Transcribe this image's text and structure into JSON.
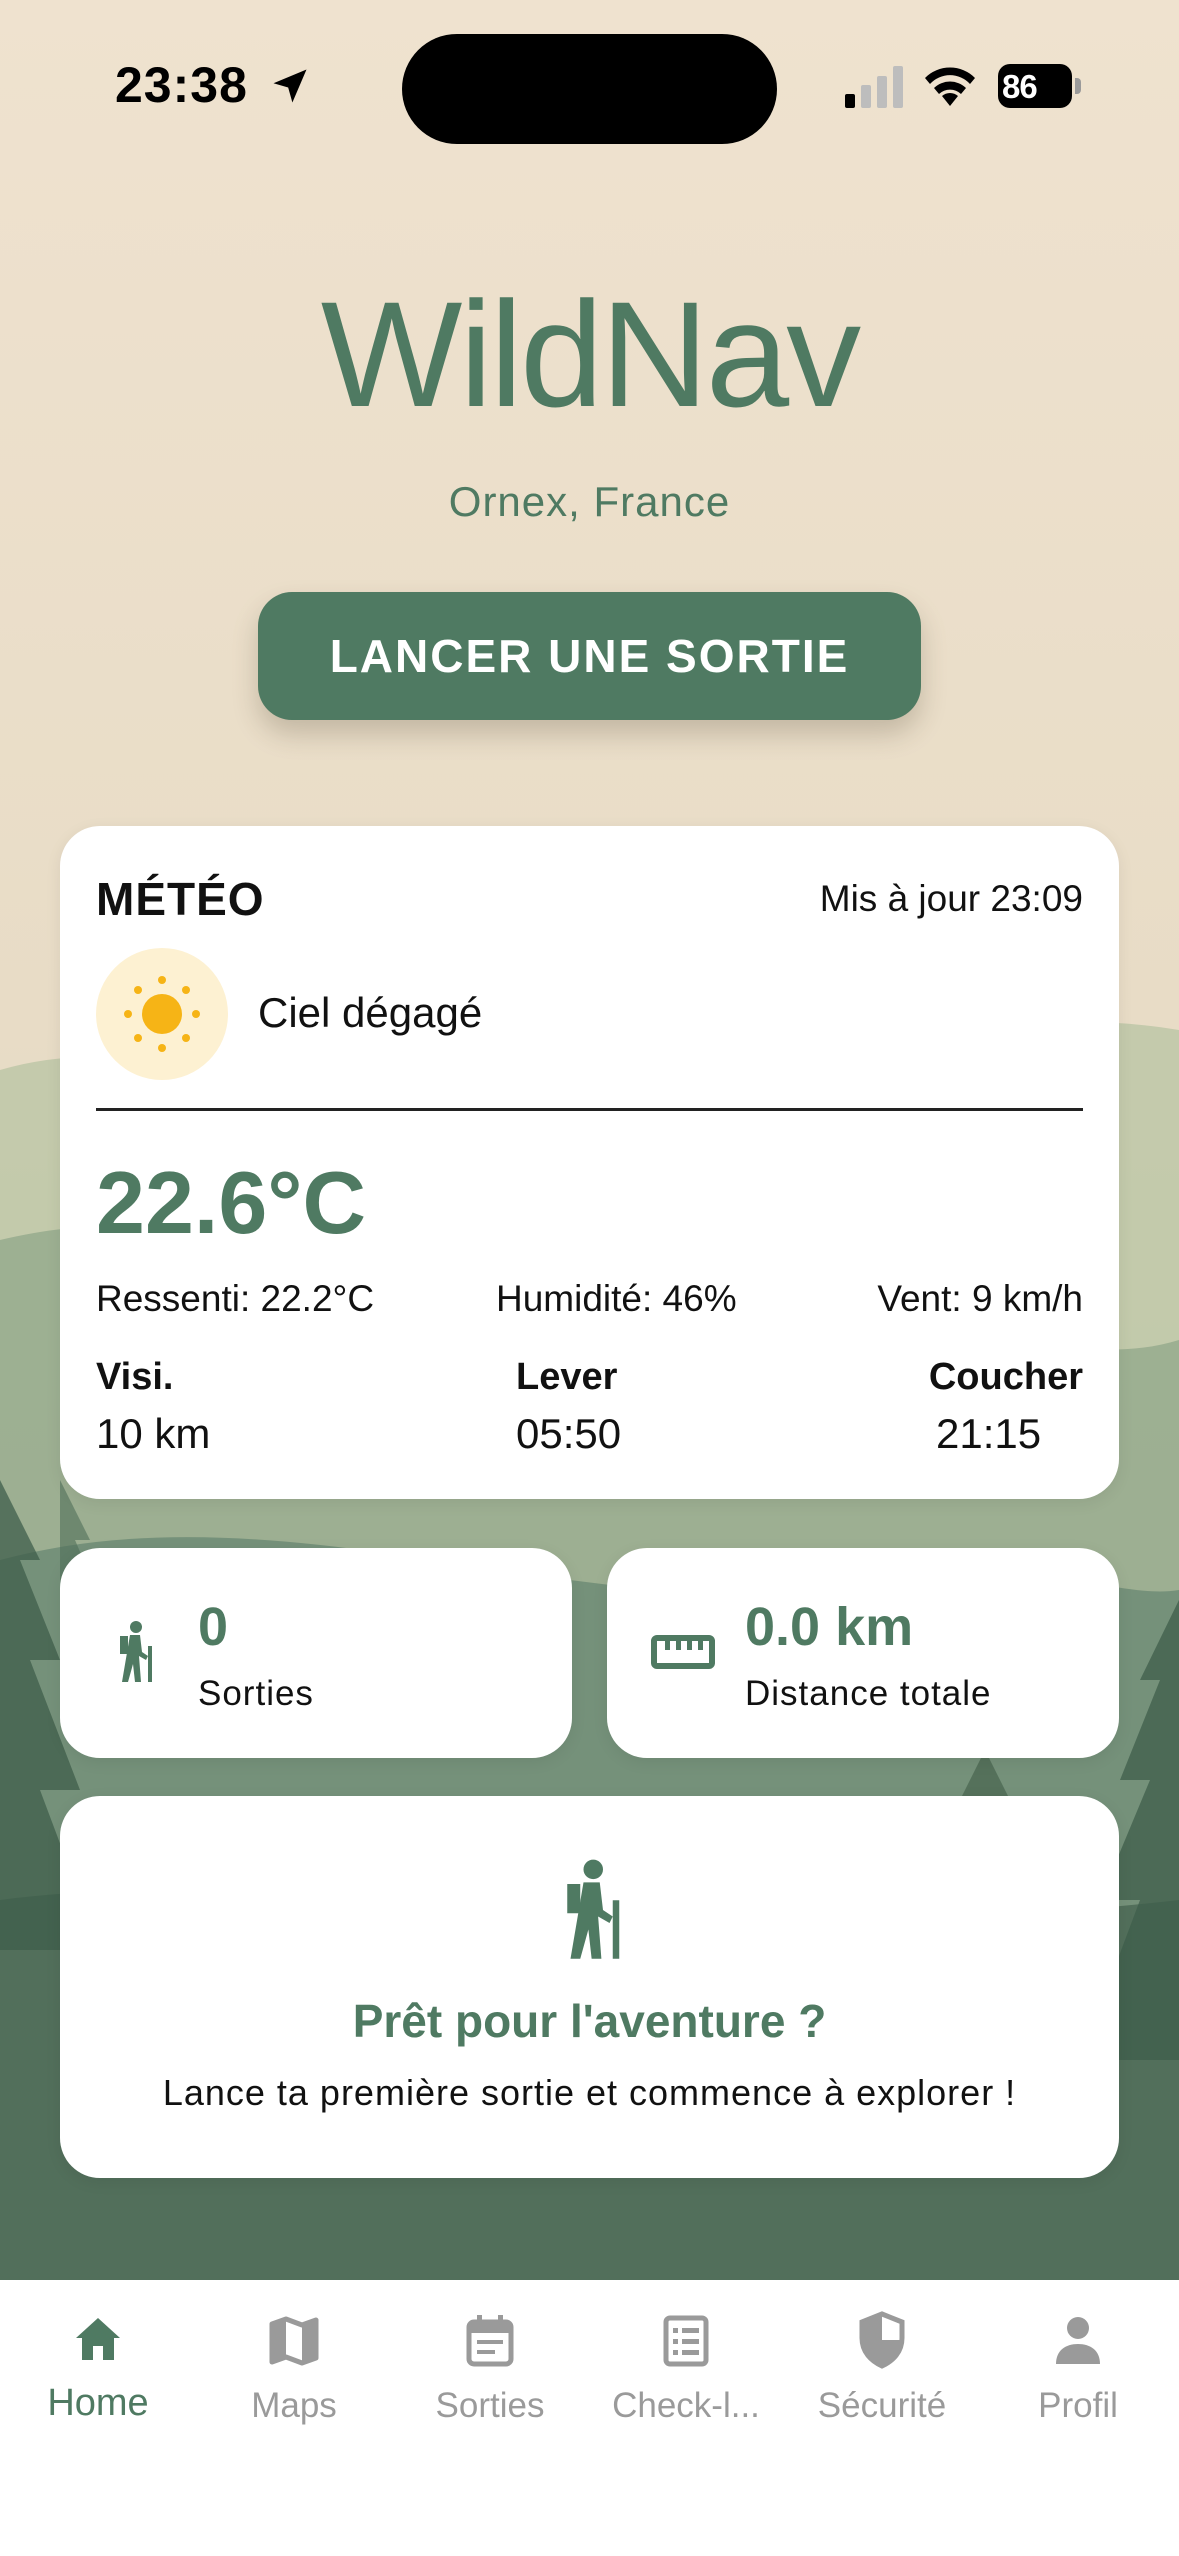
{
  "status_bar": {
    "time": "23:38",
    "battery": "86"
  },
  "header": {
    "title": "WildNav",
    "location": "Ornex, France",
    "start_button": "LANCER UNE SORTIE"
  },
  "weather": {
    "title": "MÉTÉO",
    "updated": "Mis à jour 23:09",
    "condition": "Ciel dégagé",
    "temperature": "22.6°C",
    "feels_like": "Ressenti: 22.2°C",
    "humidity": "Humidité: 46%",
    "wind": "Vent: 9 km/h",
    "visibility_label": "Visi.",
    "visibility_value": "10 km",
    "sunrise_label": "Lever",
    "sunrise_value": "05:50",
    "sunset_label": "Coucher",
    "sunset_value": "21:15"
  },
  "stats": {
    "outings_value": "0",
    "outings_label": "Sorties",
    "distance_value": "0.0 km",
    "distance_label": "Distance totale"
  },
  "adventure": {
    "title": "Prêt pour l'aventure ?",
    "text": "Lance ta première sortie et commence à explorer !"
  },
  "tabs": [
    {
      "label": "Home",
      "icon": "home-icon",
      "active": true
    },
    {
      "label": "Maps",
      "icon": "map-icon",
      "active": false
    },
    {
      "label": "Sorties",
      "icon": "calendar-icon",
      "active": false
    },
    {
      "label": "Check-l...",
      "icon": "checklist-icon",
      "active": false
    },
    {
      "label": "Sécurité",
      "icon": "shield-icon",
      "active": false
    },
    {
      "label": "Profil",
      "icon": "person-icon",
      "active": false
    }
  ],
  "colors": {
    "accent": "#4f7a62",
    "background": "#eddfca",
    "inactive": "#9a9a9a",
    "sun": "#f6b416"
  }
}
